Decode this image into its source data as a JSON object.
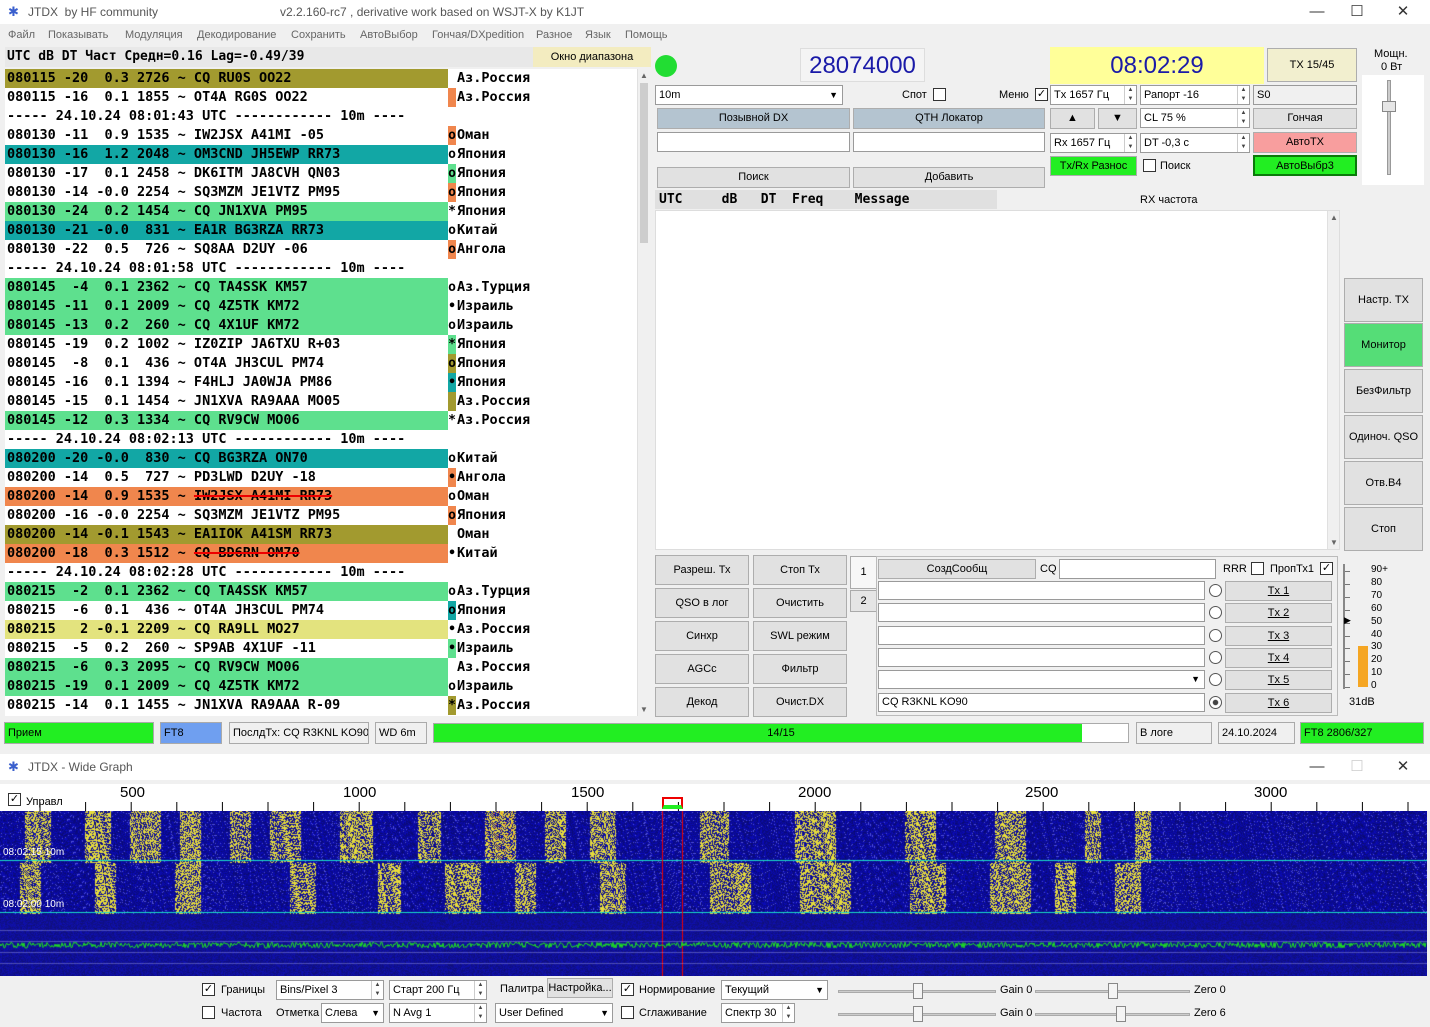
{
  "main_window": {
    "app_name": "JTDX",
    "community": "by HF community",
    "version": "v2.2.160-rc7 , derivative work based on WSJT-X by K1JT"
  },
  "menu": [
    "Файл",
    "Показывать",
    "Модуляция",
    "Декодирование",
    "Сохранить",
    "АвтоВыбор",
    "Гончая/DXpedition",
    "Разное",
    "Язык",
    "Помощь"
  ],
  "decode_header": {
    "text": "UTC     dB   DT  Част   Средн=0.16  Lag=-0.49/39",
    "band_button": "Окно диапазона"
  },
  "decodes": [
    {
      "text": "080115 -20  0.3 2726 ~ CQ RU0S OO22",
      "bg": "#a29a2f",
      "mark": " ",
      "mark_bg": "#ffffff",
      "country": "Аз.Россия",
      "strike": false
    },
    {
      "text": "080115 -16  0.1 1855 ~ OT4A RG0S OO22",
      "bg": "#ffffff",
      "mark": " ",
      "mark_bg": "#f0864d",
      "country": "Аз.Россия",
      "strike": false
    },
    {
      "text": "----- 24.10.24 08:01:43 UTC ------------ 10m ----",
      "bg": "#ffffff",
      "mark": "",
      "mark_bg": "#ffffff",
      "country": "",
      "strike": false
    },
    {
      "text": "080130 -11  0.9 1535 ~ IW2JSX A41MI -05",
      "bg": "#ffffff",
      "mark": "o",
      "mark_bg": "#f0864d",
      "country": "Оман",
      "strike": false
    },
    {
      "text": "080130 -16  1.2 2048 ~ OM3CND JH5EWP RR73",
      "bg": "#12a7a5",
      "mark": "o",
      "mark_bg": "#ffffff",
      "country": "Япония",
      "strike": false
    },
    {
      "text": "080130 -17  0.1 2458 ~ DK6ITM JA8CVH QN03",
      "bg": "#ffffff",
      "mark": "o",
      "mark_bg": "#5ee08e",
      "country": "Япония",
      "strike": false
    },
    {
      "text": "080130 -14 -0.0 2254 ~ SQ3MZM JE1VTZ PM95",
      "bg": "#ffffff",
      "mark": "o",
      "mark_bg": "#f0864d",
      "country": "Япония",
      "strike": false
    },
    {
      "text": "080130 -24  0.2 1454 ~ CQ JN1XVA PM95",
      "bg": "#5ee08e",
      "mark": "*",
      "mark_bg": "#ffffff",
      "country": "Япония",
      "strike": false
    },
    {
      "text": "080130 -21 -0.0  831 ~ EA1R BG3RZA RR73",
      "bg": "#12a7a5",
      "mark": "o",
      "mark_bg": "#ffffff",
      "country": "Китай",
      "strike": false
    },
    {
      "text": "080130 -22  0.5  726 ~ SQ8AA D2UY -06",
      "bg": "#ffffff",
      "mark": "o",
      "mark_bg": "#f0864d",
      "country": "Ангола",
      "strike": false
    },
    {
      "text": "----- 24.10.24 08:01:58 UTC ------------ 10m ----",
      "bg": "#ffffff",
      "mark": "",
      "mark_bg": "#ffffff",
      "country": "",
      "strike": false
    },
    {
      "text": "080145  -4  0.1 2362 ~ CQ TA4SSK KM57",
      "bg": "#5ee08e",
      "mark": "o",
      "mark_bg": "#ffffff",
      "country": "Аз.Турция",
      "strike": false
    },
    {
      "text": "080145 -11  0.1 2009 ~ CQ 4Z5TK KM72",
      "bg": "#5ee08e",
      "mark": "•",
      "mark_bg": "#ffffff",
      "country": "Израиль",
      "strike": false
    },
    {
      "text": "080145 -13  0.2  260 ~ CQ 4X1UF KM72",
      "bg": "#5ee08e",
      "mark": "o",
      "mark_bg": "#ffffff",
      "country": "Израиль",
      "strike": false
    },
    {
      "text": "080145 -19  0.2 1002 ~ IZ0ZIP JA6TXU R+03",
      "bg": "#ffffff",
      "mark": "*",
      "mark_bg": "#5ee08e",
      "country": "Япония",
      "strike": false
    },
    {
      "text": "080145  -8  0.1  436 ~ OT4A JH3CUL PM74",
      "bg": "#ffffff",
      "mark": "o",
      "mark_bg": "#a29a2f",
      "country": "Япония",
      "strike": false
    },
    {
      "text": "080145 -16  0.1 1394 ~ F4HLJ JA0WJA PM86",
      "bg": "#ffffff",
      "mark": "•",
      "mark_bg": "#12a7a5",
      "country": "Япония",
      "strike": false
    },
    {
      "text": "080145 -15  0.1 1454 ~ JN1XVA RA9AAA MO05",
      "bg": "#ffffff",
      "mark": " ",
      "mark_bg": "#a29a2f",
      "country": "Аз.Россия",
      "strike": false
    },
    {
      "text": "080145 -12  0.3 1334 ~ CQ RV9CW MO06",
      "bg": "#5ee08e",
      "mark": "*",
      "mark_bg": "#ffffff",
      "country": "Аз.Россия",
      "strike": false
    },
    {
      "text": "----- 24.10.24 08:02:13 UTC ------------ 10m ----",
      "bg": "#ffffff",
      "mark": "",
      "mark_bg": "#ffffff",
      "country": "",
      "strike": false
    },
    {
      "text": "080200 -20 -0.0  830 ~ CQ BG3RZA ON70",
      "bg": "#12a7a5",
      "mark": "o",
      "mark_bg": "#ffffff",
      "country": "Китай",
      "strike": false
    },
    {
      "text": "080200 -14  0.5  727 ~ PD3LWD D2UY -18",
      "bg": "#ffffff",
      "mark": "•",
      "mark_bg": "#f0864d",
      "country": "Ангола",
      "strike": false
    },
    {
      "text": "080200 -14  0.9 1535 ~ IW2JSX A41MI RR73",
      "bg": "#f0864d",
      "mark": "o",
      "mark_bg": "#ffffff",
      "country": "Оман",
      "strike": true,
      "strike_from": 23
    },
    {
      "text": "080200 -16 -0.0 2254 ~ SQ3MZM JE1VTZ PM95",
      "bg": "#ffffff",
      "mark": "o",
      "mark_bg": "#f0864d",
      "country": "Япония",
      "strike": false
    },
    {
      "text": "080200 -14 -0.1 1543 ~ EA1IOK A41SM RR73",
      "bg": "#a29a2f",
      "mark": " ",
      "mark_bg": "#ffffff",
      "country": "Оман",
      "strike": false
    },
    {
      "text": "080200 -18  0.3 1512 ~ CQ BD6RN OM70",
      "bg": "#f0864d",
      "mark": "•",
      "mark_bg": "#ffffff",
      "country": "Китай",
      "strike": true,
      "strike_from": 23
    },
    {
      "text": "----- 24.10.24 08:02:28 UTC ------------ 10m ----",
      "bg": "#ffffff",
      "mark": "",
      "mark_bg": "#ffffff",
      "country": "",
      "strike": false
    },
    {
      "text": "080215  -2  0.1 2362 ~ CQ TA4SSK KM57",
      "bg": "#5ee08e",
      "mark": "o",
      "mark_bg": "#ffffff",
      "country": "Аз.Турция",
      "strike": false
    },
    {
      "text": "080215  -6  0.1  436 ~ OT4A JH3CUL PM74",
      "bg": "#ffffff",
      "mark": "o",
      "mark_bg": "#12a7a5",
      "country": "Япония",
      "strike": false
    },
    {
      "text": "080215   2 -0.1 2209 ~ CQ RA9LL MO27",
      "bg": "#e3e37e",
      "mark": "•",
      "mark_bg": "#ffffff",
      "country": "Аз.Россия",
      "strike": false
    },
    {
      "text": "080215  -5  0.2  260 ~ SP9AB 4X1UF -11",
      "bg": "#ffffff",
      "mark": "•",
      "mark_bg": "#5ee08e",
      "country": "Израиль",
      "strike": false
    },
    {
      "text": "080215  -6  0.3 2095 ~ CQ RV9CW MO06",
      "bg": "#5ee08e",
      "mark": " ",
      "mark_bg": "#ffffff",
      "country": "Аз.Россия",
      "strike": false
    },
    {
      "text": "080215 -19  0.1 2009 ~ CQ 4Z5TK KM72",
      "bg": "#5ee08e",
      "mark": "o",
      "mark_bg": "#ffffff",
      "country": "Израиль",
      "strike": false
    },
    {
      "text": "080215 -14  0.1 1455 ~ JN1XVA RA9AAA R-09",
      "bg": "#ffffff",
      "mark": "*",
      "mark_bg": "#a29a2f",
      "country": "Аз.Россия",
      "strike": false
    }
  ],
  "right": {
    "frequency": "28074000",
    "clock": "08:02:29",
    "tx_counter": "TX 15/45",
    "power_label": "Мощн.",
    "power_value": "0 Вт",
    "band": "10m",
    "spot_label": "Спот",
    "menu_label": "Меню",
    "menu_checked": "✓",
    "tx_freq": "Tx  1657  Гц",
    "rx_freq": "Rx  1657  Гц",
    "report": "Рапорт -16",
    "s_value": "S0",
    "cl": "CL  75 %",
    "dt": "DT -0,3 с",
    "up_arrow": "▲",
    "down_arrow": "▼",
    "dx_call_btn": "Позывной DX",
    "qth_btn": "QTH Локатор",
    "search_btn": "Поиск",
    "add_btn": "Добавить",
    "hound_btn": "Гончая",
    "autotx_btn": "АвтоТХ",
    "txrx_split_btn": "Tx/Rx Разнос",
    "search_chk_label": "Поиск",
    "autoselect_btn": "АвтоВыбр3",
    "rx_header": "UTC     dB   DT  Freq    Message",
    "rx_freq_label": "RX частота"
  },
  "side_buttons": [
    "Настр. TX",
    "Монитор",
    "БезФильтр",
    "Одиноч. QSO",
    "Отв.В4",
    "Стоп"
  ],
  "bottom_buttons": {
    "left": [
      "Разреш. Тх",
      "QSO в лог",
      "Синхр",
      "AGCc",
      "Декод"
    ],
    "right": [
      "Стоп Тх",
      "Очистить",
      "SWL режим",
      "Фильтр",
      "Очист.DX"
    ]
  },
  "tx_panel": {
    "tab1": "1",
    "tab2": "2",
    "gen_btn": "СоздСообщ",
    "cq_label": "CQ",
    "rrr_label": "RRR",
    "skip_tx1_label": "ПропТх1",
    "skip_tx1_checked": "✓",
    "tx_buttons": [
      "Tx 1",
      "Tx 2",
      "Tx 3",
      "Tx 4",
      "Tx 5",
      "Tx 6"
    ],
    "tx6_message": "CQ R3KNL KO90"
  },
  "meter": {
    "ticks": [
      "90+",
      "80",
      "70",
      "60",
      "50",
      "40",
      "30",
      "20",
      "10",
      "0"
    ],
    "value": "31dB",
    "pointer": "▶"
  },
  "status": {
    "mode_state": "Прием",
    "mode": "FT8",
    "last_tx": "ПослдТх: CQ R3KNL KO90",
    "wd": "WD 6m",
    "progress_text": "14/15",
    "progress_fraction": 0.933,
    "logged": "В логе",
    "date": "24.10.2024",
    "mode_count": "FT8  2806/327"
  },
  "wide_graph": {
    "title": "JTDX - Wide Graph",
    "control_label": "Управл",
    "scale": [
      "500",
      "1000",
      "1500",
      "2000",
      "2500",
      "3000"
    ],
    "wf_label1": "08:02:15   10m",
    "wf_label2": "08:02:00   10m",
    "controls": {
      "bounds": "Границы",
      "freq": "Частота",
      "bins": "Bins/Pixel  3",
      "mark_label": "Отметка",
      "mark_value": "Слева",
      "start": "Старт 200 Гц",
      "navg": "N Avg 1",
      "palette": "Палитра",
      "palette_btn": "Настройка...",
      "user_defined": "User Defined",
      "normalize": "Нормирование",
      "smoothing": "Сглаживание",
      "current": "Текущий",
      "spectrum": "Спектр 30",
      "gain1": "Gain 0",
      "zero1": "Zero 0",
      "gain2": "Gain 0",
      "zero2": "Zero 6"
    }
  },
  "colors": {
    "accent_green": "#22ee22",
    "freq_blue": "#1a1aa8",
    "clock_bg": "#ffff99",
    "autotx_bg": "#f89e9e",
    "monitor_bg": "#55dd77",
    "dx_btn_bg": "#b4c4d0",
    "waterfall_bg": "#0a0a6a"
  }
}
